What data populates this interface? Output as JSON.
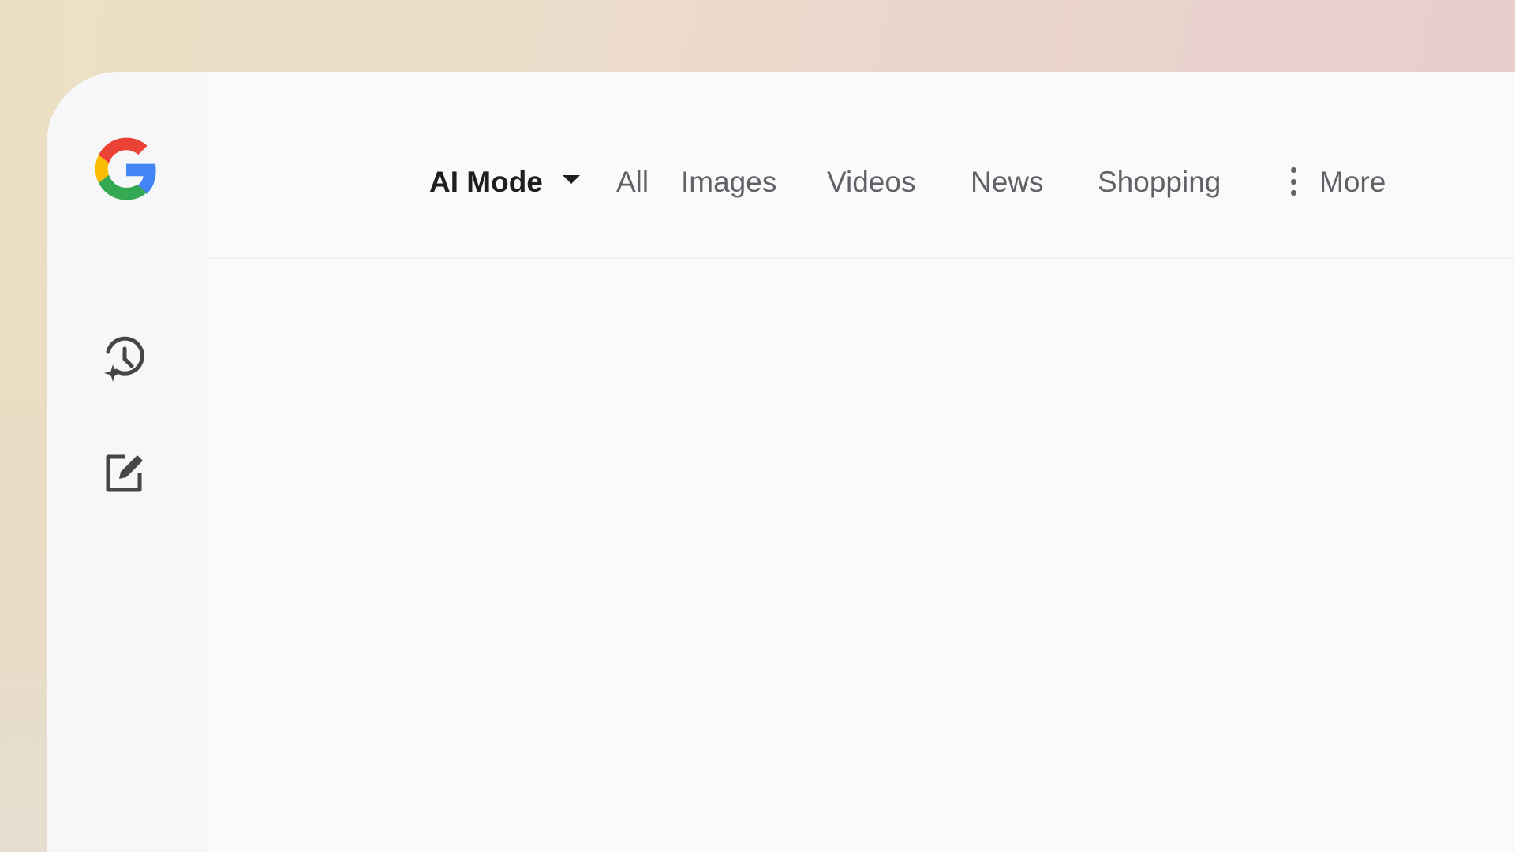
{
  "nav": {
    "tabs": [
      {
        "label": "AI Mode",
        "active": true
      },
      {
        "label": "All"
      },
      {
        "label": "Images"
      },
      {
        "label": "Videos"
      },
      {
        "label": "News"
      },
      {
        "label": "Shopping"
      },
      {
        "label": "More"
      }
    ]
  },
  "sidebar": {
    "logo": "google-g-logo",
    "buttons": [
      {
        "icon": "history-sparkle-icon"
      },
      {
        "icon": "new-chat-edit-icon"
      }
    ]
  },
  "colors": {
    "active_text": "#1f1f1f",
    "inactive_text": "#5f6368",
    "icon": "#444746",
    "google_blue": "#4285F4",
    "google_red": "#EA4335",
    "google_yellow": "#FBBC05",
    "google_green": "#34A853"
  }
}
